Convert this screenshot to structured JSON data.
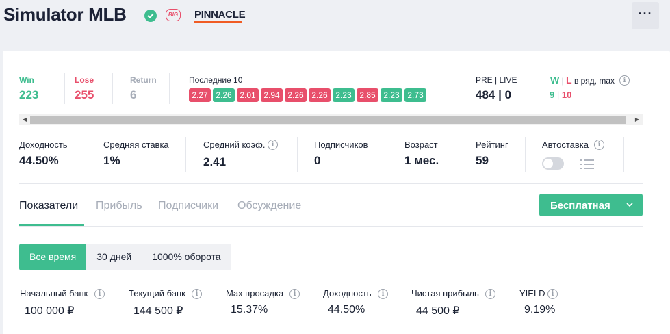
{
  "header": {
    "title": "Simulator MLB",
    "badge_big": "BIG",
    "bookmaker": "PINNACLE",
    "more": "···"
  },
  "summary": {
    "win_label": "Win",
    "win_value": "223",
    "lose_label": "Lose",
    "lose_value": "255",
    "return_label": "Return",
    "return_value": "6",
    "last10_label": "Последние 10",
    "last10": [
      {
        "odds": "2.27",
        "result": "L"
      },
      {
        "odds": "2.26",
        "result": "W"
      },
      {
        "odds": "2.01",
        "result": "L"
      },
      {
        "odds": "2.94",
        "result": "L"
      },
      {
        "odds": "2.26",
        "result": "L"
      },
      {
        "odds": "2.26",
        "result": "L"
      },
      {
        "odds": "2.23",
        "result": "W"
      },
      {
        "odds": "2.85",
        "result": "L"
      },
      {
        "odds": "2.23",
        "result": "W"
      },
      {
        "odds": "2.73",
        "result": "W"
      }
    ],
    "prelive_label": "PRE | LIVE",
    "prelive_value": "484 | 0",
    "streak_w": "W",
    "streak_sep": "|",
    "streak_l": "L",
    "streak_label": "в ряд, max",
    "streak_w_value": "9",
    "streak_sep2": "|",
    "streak_l_value": "10"
  },
  "metrics": {
    "yield_label": "Доходность",
    "yield_value": "44.50%",
    "avg_stake_label": "Средняя ставка",
    "avg_stake_value": "1%",
    "avg_odds_label": "Средний коэф.",
    "avg_odds_value": "2.41",
    "subs_label": "Подписчиков",
    "subs_value": "0",
    "age_label": "Возраст",
    "age_value": "1 мес.",
    "rating_label": "Рейтинг",
    "rating_value": "59",
    "autobet_label": "Автоставка",
    "autobet_on": false
  },
  "tabs": [
    "Показатели",
    "Прибыль",
    "Подписчики",
    "Обсуждение"
  ],
  "subscribe_button": "Бесплатная",
  "periods": [
    "Все время",
    "30 дней",
    "1000% оборота"
  ],
  "bank": {
    "start_label": "Начальный банк",
    "start_value": "100 000 ₽",
    "current_label": "Текущий банк",
    "current_value": "144 500 ₽",
    "drawdown_label": "Max просадка",
    "drawdown_value": "15.37%",
    "yield_label": "Доходность",
    "yield_value": "44.50%",
    "profit_label": "Чистая прибыль",
    "profit_value": "44 500 ₽",
    "yieldpct_label": "YIELD",
    "yieldpct_value": "9.19%"
  },
  "colors": {
    "accent_green": "#3ebd8f",
    "lose_red": "#e84f6b",
    "return_grey": "#a7adb8",
    "text_dark": "#1b2233"
  }
}
